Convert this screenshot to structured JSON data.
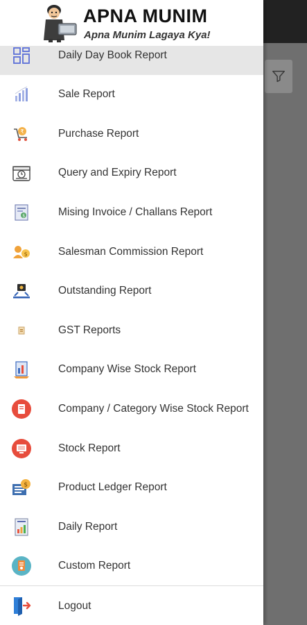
{
  "brand": {
    "name": "APNA MUNIM",
    "tagline": "Apna Munim Lagaya Kya!"
  },
  "menu": {
    "items": [
      {
        "label": "Daily Day Book Report",
        "icon": "grid-layout-icon"
      },
      {
        "label": "Sale Report",
        "icon": "bar-chart-icon"
      },
      {
        "label": "Purchase Report",
        "icon": "shopping-cart-icon"
      },
      {
        "label": "Query and Expiry Report",
        "icon": "calendar-icon"
      },
      {
        "label": "Mising Invoice / Challans Report",
        "icon": "invoice-icon"
      },
      {
        "label": "Salesman Commission Report",
        "icon": "commission-icon"
      },
      {
        "label": "Outstanding Report",
        "icon": "outstanding-icon"
      },
      {
        "label": "GST Reports",
        "icon": "gst-icon"
      },
      {
        "label": "Company Wise Stock Report",
        "icon": "company-stock-icon"
      },
      {
        "label": "Company / Category Wise Stock Report",
        "icon": "category-stock-icon"
      },
      {
        "label": "Stock Report",
        "icon": "stock-icon"
      },
      {
        "label": "Product Ledger Report",
        "icon": "ledger-icon"
      },
      {
        "label": "Daily Report",
        "icon": "daily-report-icon"
      },
      {
        "label": "Custom Report",
        "icon": "custom-report-icon"
      }
    ],
    "logout_label": "Logout"
  },
  "colors": {
    "active_row": "#e6e6e6",
    "topbar": "#222222",
    "scrim": "#6f6f6f"
  }
}
